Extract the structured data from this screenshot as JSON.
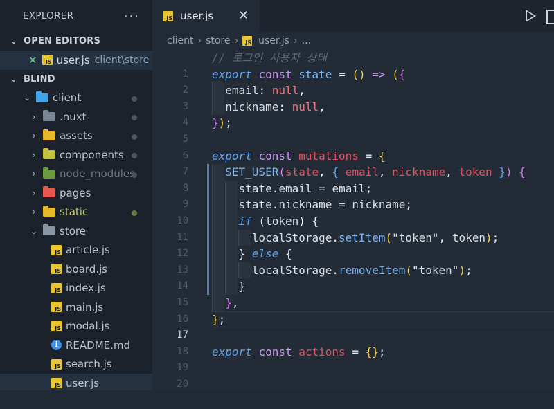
{
  "sidebar": {
    "title": "EXPLORER",
    "more": "···",
    "open_editors": {
      "title": "OPEN EDITORS",
      "file": "user.js",
      "path": "client\\store"
    },
    "project": {
      "title": "BLIND",
      "items": [
        {
          "label": "client",
          "kind": "folder"
        },
        {
          "label": ".nuxt",
          "kind": "folder"
        },
        {
          "label": "assets",
          "kind": "folder"
        },
        {
          "label": "components",
          "kind": "folder"
        },
        {
          "label": "node_modules",
          "kind": "folder"
        },
        {
          "label": "pages",
          "kind": "folder"
        },
        {
          "label": "static",
          "kind": "folder"
        },
        {
          "label": "store",
          "kind": "folder"
        },
        {
          "label": "article.js",
          "kind": "js"
        },
        {
          "label": "board.js",
          "kind": "js"
        },
        {
          "label": "index.js",
          "kind": "js"
        },
        {
          "label": "main.js",
          "kind": "js"
        },
        {
          "label": "modal.js",
          "kind": "js"
        },
        {
          "label": "README.md",
          "kind": "info"
        },
        {
          "label": "search.js",
          "kind": "js"
        },
        {
          "label": "user.js",
          "kind": "js"
        }
      ]
    }
  },
  "tab": {
    "label": "user.js",
    "close": "✕"
  },
  "breadcrumb": [
    "client",
    "store",
    "user.js",
    "..."
  ],
  "js_badge": "JS",
  "current_line": 17,
  "line_numbers": [
    "1",
    "2",
    "3",
    "4",
    "5",
    "6",
    "7",
    "8",
    "9",
    "10",
    "11",
    "12",
    "13",
    "14",
    "15",
    "16",
    "17",
    "18",
    "19",
    "20"
  ],
  "code": {
    "l1_comment": "// 로그인 사용자 상태",
    "kw_export": "export",
    "kw_const": "const",
    "state": "state",
    "mutations": "mutations",
    "actions": "actions",
    "email": "email",
    "nickname": "nickname",
    "token": "token",
    "null": "null",
    "set_user": "SET_USER",
    "kw_if": "if",
    "kw_else": "else",
    "localStorage": "localStorage",
    "setItem": "setItem",
    "removeItem": "removeItem",
    "str_token": "\"token\""
  },
  "colors": {
    "keyword": "#5fa3f0",
    "variable": "#e2535f",
    "function": "#7ab3f5",
    "bracket_yellow": "#f1d04a",
    "bracket_purple": "#d57af2",
    "js_icon": "#e8c42f"
  }
}
